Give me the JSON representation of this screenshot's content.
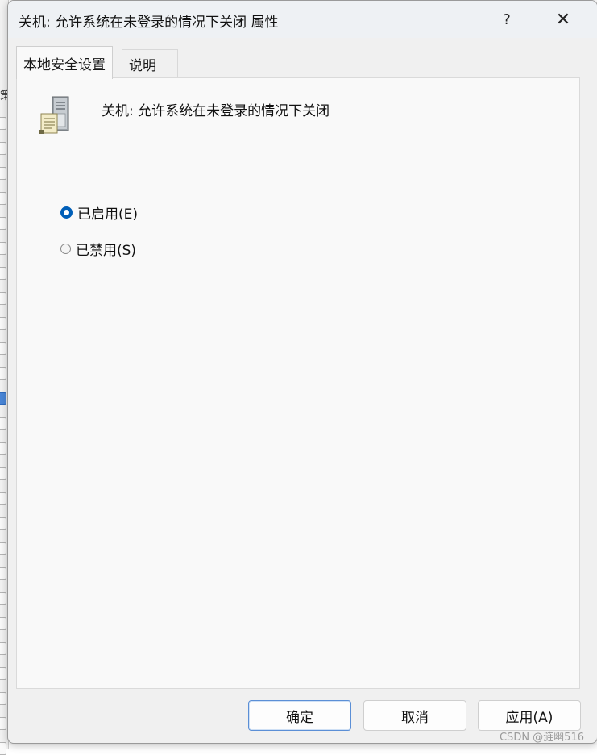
{
  "dialog": {
    "title": "关机: 允许系统在未登录的情况下关闭 属性",
    "help_label": "?",
    "close_label": "✕"
  },
  "tabs": [
    {
      "label": "本地安全设置",
      "active": true
    },
    {
      "label": "说明",
      "active": false
    }
  ],
  "policy": {
    "icon": "server-icon",
    "name": "关机: 允许系统在未登录的情况下关闭"
  },
  "options": [
    {
      "label": "已启用(E)",
      "checked": true
    },
    {
      "label": "已禁用(S)",
      "checked": false
    }
  ],
  "buttons": {
    "ok": "确定",
    "cancel": "取消",
    "apply": "应用(A)"
  },
  "background": {
    "partial_char": "策"
  },
  "watermark": "CSDN @涟幽516",
  "colors": {
    "accent": "#005fb8",
    "titlebar": "#eef1f4",
    "panel": "#f9f9f9"
  }
}
